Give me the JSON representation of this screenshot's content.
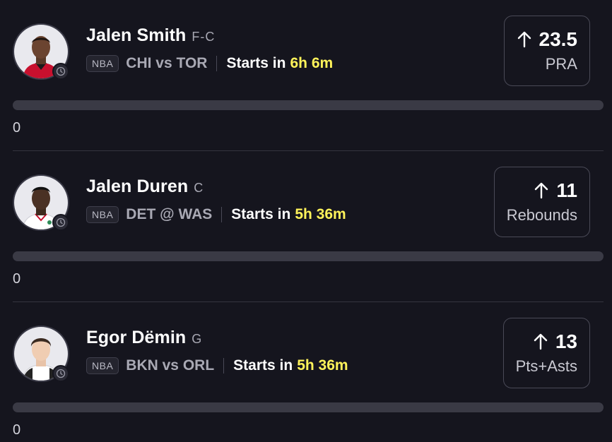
{
  "projections": [
    {
      "player_name": "Jalen Smith",
      "position": "F-C",
      "league": "NBA",
      "matchup": "CHI vs TOR",
      "starts_label": "Starts in",
      "starts_time": "6h 6m",
      "direction_icon": "arrow-up-icon",
      "line_value": "23.5",
      "stat_label": "PRA",
      "jersey_color": "#c8102e",
      "progress_fraction": 0,
      "progress_count": "0"
    },
    {
      "player_name": "Jalen Duren",
      "position": "C",
      "league": "NBA",
      "matchup": "DET @ WAS",
      "starts_label": "Starts in",
      "starts_time": "5h 36m",
      "direction_icon": "arrow-up-icon",
      "line_value": "11",
      "stat_label": "Rebounds",
      "jersey_color": "#ffffff",
      "progress_fraction": 0,
      "progress_count": "0"
    },
    {
      "player_name": "Egor Dëmin",
      "position": "G",
      "league": "NBA",
      "matchup": "BKN vs ORL",
      "starts_label": "Starts in",
      "starts_time": "5h 36m",
      "direction_icon": "arrow-up-icon",
      "line_value": "13",
      "stat_label": "Pts+Asts",
      "jersey_color": "#ffffff",
      "progress_fraction": 0,
      "progress_count": "0"
    }
  ],
  "colors": {
    "background": "#15151e",
    "highlight_time": "#fff35a",
    "progress_track": "#3a3a45"
  }
}
